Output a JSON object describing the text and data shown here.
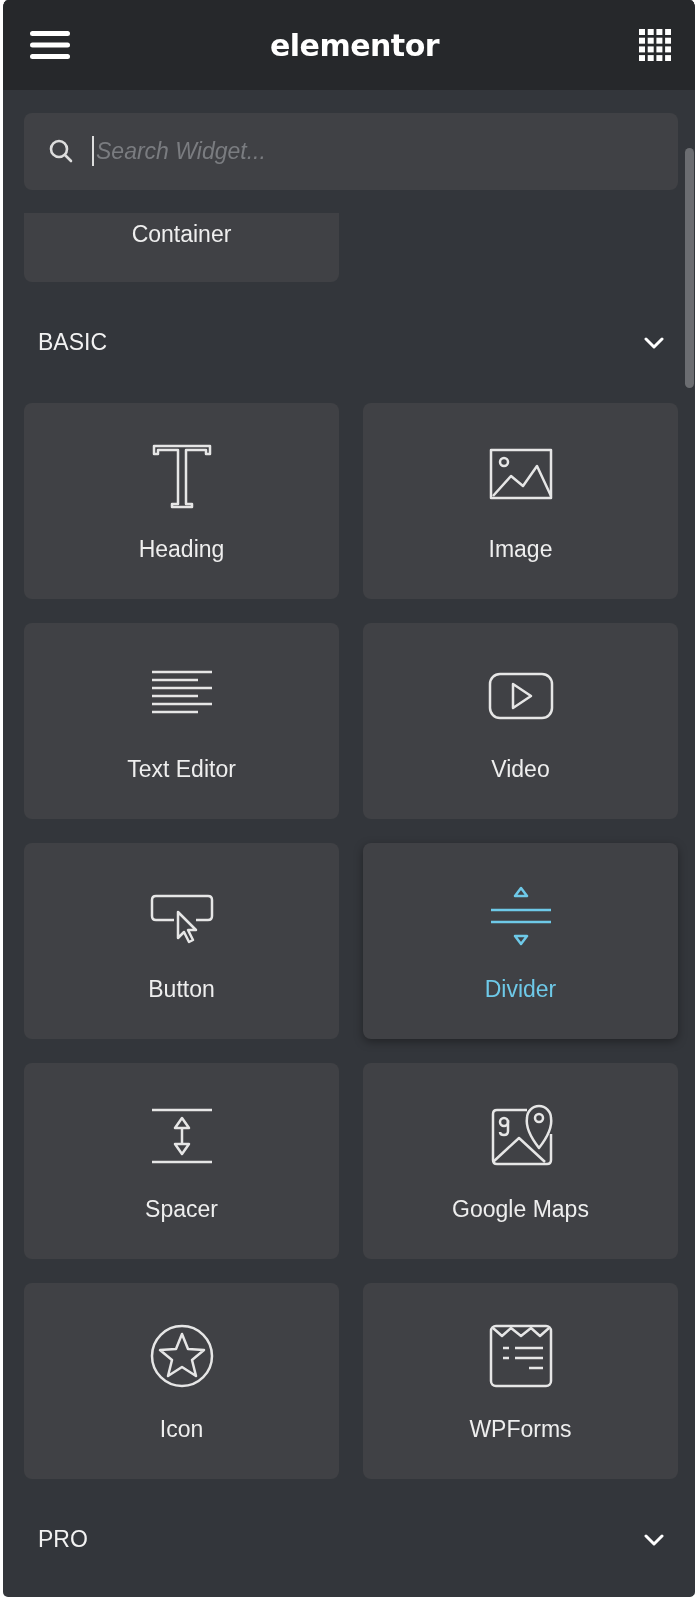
{
  "header": {
    "logo": "elementor"
  },
  "search": {
    "placeholder": "Search Widget..."
  },
  "top_widgets": [
    {
      "label": "Container",
      "active": false
    }
  ],
  "sections": [
    {
      "title": "BASIC",
      "widgets": [
        {
          "label": "Heading",
          "kind": "heading",
          "active": false
        },
        {
          "label": "Image",
          "kind": "image",
          "active": false
        },
        {
          "label": "Text Editor",
          "kind": "text",
          "active": false
        },
        {
          "label": "Video",
          "kind": "video",
          "active": false
        },
        {
          "label": "Button",
          "kind": "button",
          "active": false
        },
        {
          "label": "Divider",
          "kind": "divider",
          "active": true
        },
        {
          "label": "Spacer",
          "kind": "spacer",
          "active": false
        },
        {
          "label": "Google Maps",
          "kind": "map",
          "active": false
        },
        {
          "label": "Icon",
          "kind": "icon",
          "active": false
        },
        {
          "label": "WPForms",
          "kind": "form",
          "active": false
        }
      ]
    },
    {
      "title": "PRO"
    }
  ]
}
